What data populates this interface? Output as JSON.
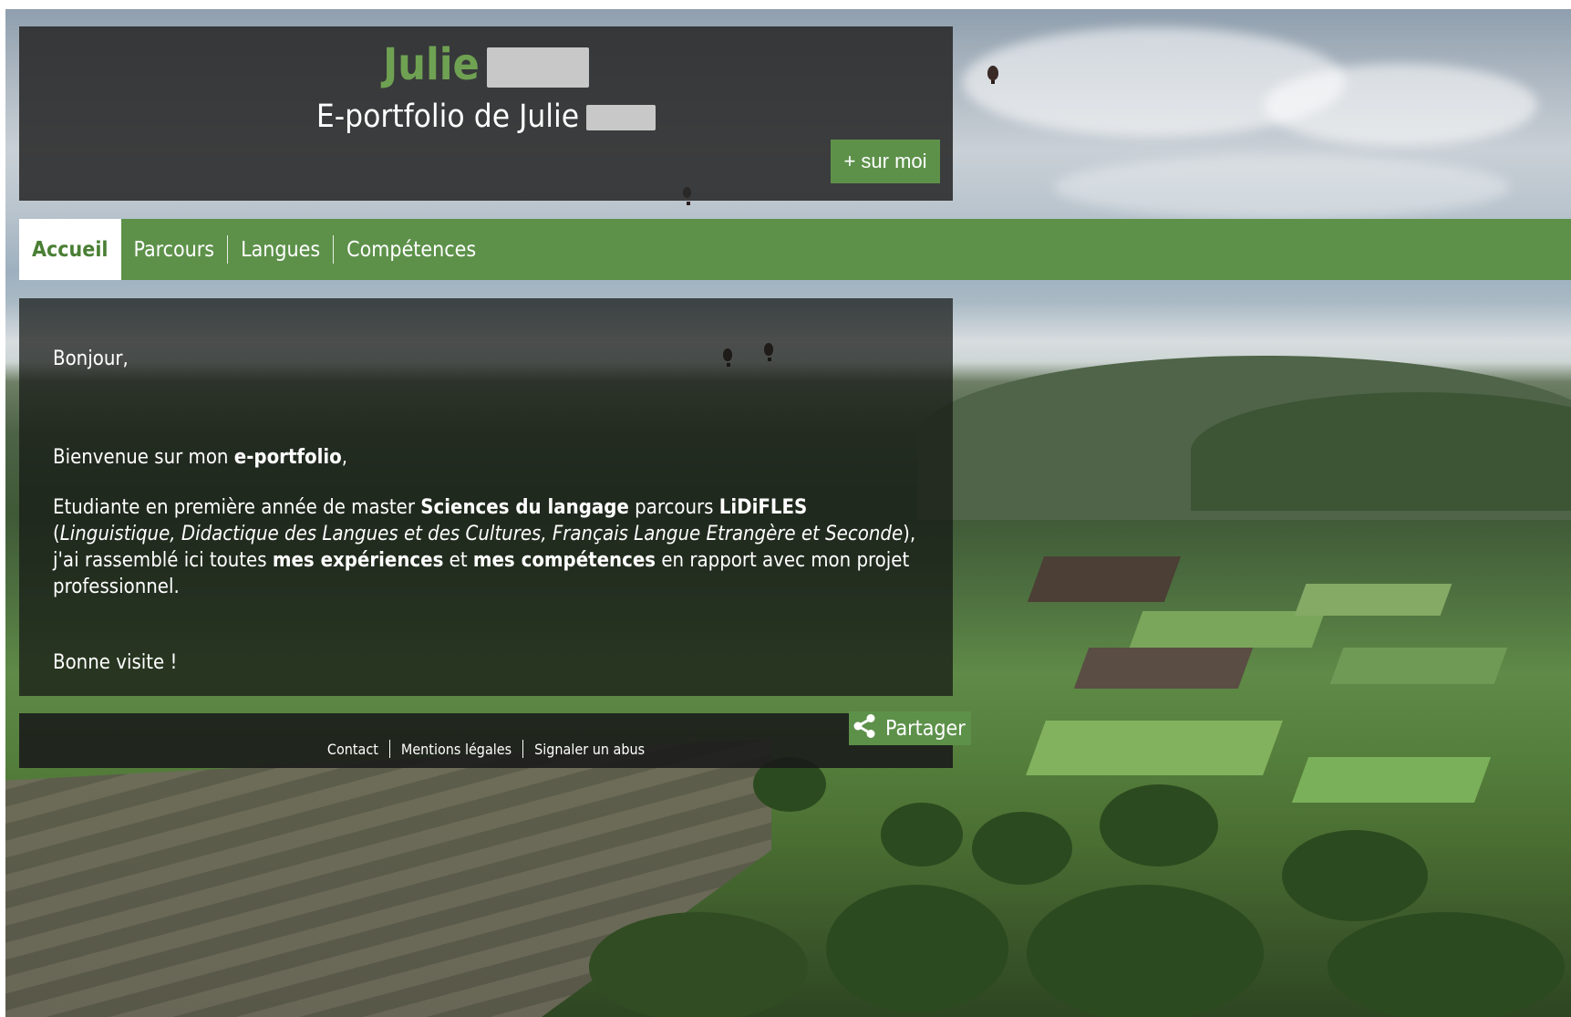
{
  "header": {
    "title": "Julie",
    "subtitle": "E-portfolio de Julie",
    "about_button": "+ sur moi"
  },
  "nav": {
    "items": [
      {
        "label": "Accueil",
        "active": true
      },
      {
        "label": "Parcours",
        "active": false
      },
      {
        "label": "Langues",
        "active": false
      },
      {
        "label": "Compétences",
        "active": false
      }
    ]
  },
  "content": {
    "greeting": "Bonjour,",
    "welcome_pre": "Bienvenue sur mon ",
    "welcome_bold": "e-portfolio",
    "welcome_post": ",",
    "intro_1": "Etudiante en première année de master ",
    "intro_bold_1": "Sciences du langage",
    "intro_2": " parcours ",
    "intro_bold_2": "LiDiFLES",
    "intro_3": " (",
    "intro_italic": "Linguistique, Didactique des Langues et des Cultures, Français Langue Etrangère et Seconde",
    "intro_4": "), j'ai rassemblé ici toutes ",
    "intro_bold_3": "mes expériences",
    "intro_5": " et ",
    "intro_bold_4": "mes compétences",
    "intro_6": " en rapport avec mon projet professionnel.",
    "closing": "Bonne visite !"
  },
  "footer": {
    "share_button": "Partager",
    "links": [
      "Contact",
      "Mentions légales",
      "Signaler un abus"
    ]
  },
  "colors": {
    "accent_green": "#5d914a",
    "title_green": "#6fa152"
  }
}
